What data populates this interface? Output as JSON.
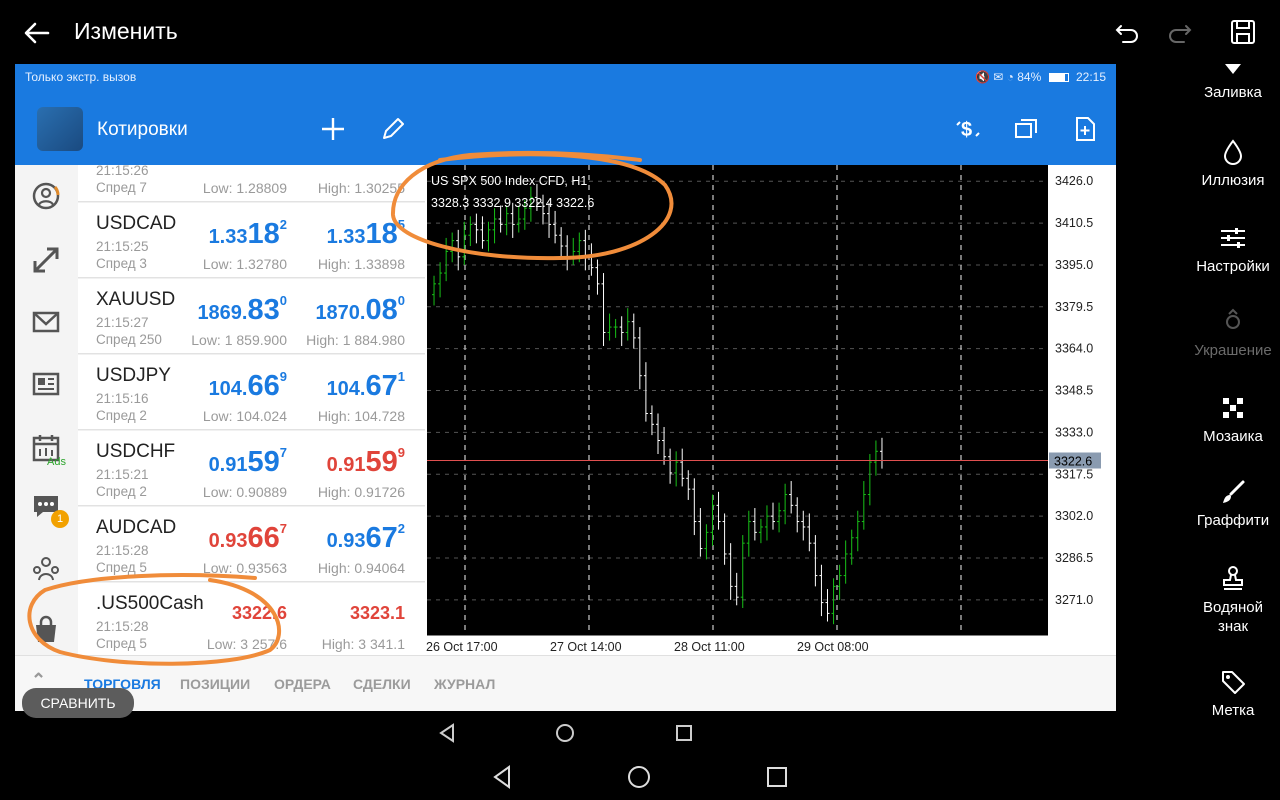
{
  "editor": {
    "title": "Изменить",
    "tools": [
      {
        "label": "Заливка",
        "icon": "fill-icon",
        "disabled": false
      },
      {
        "label": "Иллюзия",
        "icon": "drop-icon",
        "disabled": false
      },
      {
        "label": "Настройки",
        "icon": "sliders-icon",
        "disabled": false
      },
      {
        "label": "Украшение",
        "icon": "decoration-icon",
        "disabled": true
      },
      {
        "label": "Мозаика",
        "icon": "mosaic-icon",
        "disabled": false
      },
      {
        "label": "Граффити",
        "icon": "brush-icon",
        "disabled": false
      },
      {
        "label": "Водяной знак",
        "icon": "watermark-icon",
        "disabled": false
      },
      {
        "label": "Метка",
        "icon": "tag-icon",
        "disabled": false
      }
    ]
  },
  "statusbar": {
    "left": "Только экстр. вызов",
    "battery": "84%",
    "time": "22:15"
  },
  "appbar": {
    "title": "Котировки"
  },
  "leftnav": {
    "ads_label": "Ads",
    "chat_badge": "1"
  },
  "quotes": [
    {
      "symbol": "",
      "time": "21:15:26",
      "spread": "Спред 7",
      "bid_pre": "",
      "bid_big": "",
      "bid_sup": "",
      "ask_pre": "",
      "ask_big": "",
      "ask_sup": "",
      "low": "Low: 1.28809",
      "high": "High: 1.30255",
      "bid_color": "blue",
      "ask_color": "blue"
    },
    {
      "symbol": "USDCAD",
      "time": "21:15:25",
      "spread": "Спред 3",
      "bid_pre": "1.33",
      "bid_big": "18",
      "bid_sup": "2",
      "ask_pre": "1.33",
      "ask_big": "18",
      "ask_sup": "5",
      "low": "Low: 1.32780",
      "high": "High: 1.33898",
      "bid_color": "blue",
      "ask_color": "blue"
    },
    {
      "symbol": "XAUUSD",
      "time": "21:15:27",
      "spread": "Спред 250",
      "bid_pre": "1869.",
      "bid_big": "83",
      "bid_sup": "0",
      "ask_pre": "1870.",
      "ask_big": "08",
      "ask_sup": "0",
      "low": "Low: 1 859.900",
      "high": "High: 1 884.980",
      "bid_color": "blue",
      "ask_color": "blue"
    },
    {
      "symbol": "USDJPY",
      "time": "21:15:16",
      "spread": "Спред 2",
      "bid_pre": "104.",
      "bid_big": "66",
      "bid_sup": "9",
      "ask_pre": "104.",
      "ask_big": "67",
      "ask_sup": "1",
      "low": "Low: 104.024",
      "high": "High: 104.728",
      "bid_color": "blue",
      "ask_color": "blue"
    },
    {
      "symbol": "USDCHF",
      "time": "21:15:21",
      "spread": "Спред 2",
      "bid_pre": "0.91",
      "bid_big": "59",
      "bid_sup": "7",
      "ask_pre": "0.91",
      "ask_big": "59",
      "ask_sup": "9",
      "low": "Low: 0.90889",
      "high": "High: 0.91726",
      "bid_color": "blue",
      "ask_color": "red"
    },
    {
      "symbol": "AUDCAD",
      "time": "21:15:28",
      "spread": "Спред 5",
      "bid_pre": "0.93",
      "bid_big": "66",
      "bid_sup": "7",
      "ask_pre": "0.93",
      "ask_big": "67",
      "ask_sup": "2",
      "low": "Low: 0.93563",
      "high": "High: 0.94064",
      "bid_color": "red",
      "ask_color": "blue"
    },
    {
      "symbol": ".US500Cash",
      "time": "21:15:28",
      "spread": "Спред 5",
      "bid_plain": "3322.6",
      "ask_plain": "3323.1",
      "low": "Low: 3 257.6",
      "high": "High: 3 341.1",
      "bid_color": "red",
      "ask_color": "red"
    }
  ],
  "chart": {
    "title": "US SPX 500 Index CFD, H1",
    "ohlc": "3328.3 3332.9 3322.4 3322.6",
    "current_price_label": "3322.6",
    "y_ticks": [
      "3426.0",
      "3410.5",
      "3395.0",
      "3379.5",
      "3364.0",
      "3348.5",
      "3333.0",
      "3317.5",
      "3302.0",
      "3286.5",
      "3271.0"
    ],
    "x_ticks": [
      "26 Oct 17:00",
      "27 Oct 14:00",
      "28 Oct 11:00",
      "29 Oct 08:00"
    ],
    "colors": {
      "bull": "#18c018",
      "bear": "#ffffff",
      "bg": "#000000",
      "price_line": "#e05050",
      "grid": "#ffffff"
    }
  },
  "chart_data": {
    "type": "candlestick",
    "title": "US SPX 500 Index CFD, H1",
    "ylim": [
      3258,
      3432
    ],
    "current_price": 3322.6,
    "x_tick_labels": [
      "26 Oct 17:00",
      "27 Oct 14:00",
      "28 Oct 11:00",
      "29 Oct 08:00"
    ],
    "closes": [
      3388,
      3392,
      3400,
      3404,
      3398,
      3406,
      3410,
      3408,
      3404,
      3408,
      3412,
      3410,
      3414,
      3410,
      3412,
      3416,
      3420,
      3418,
      3414,
      3410,
      3406,
      3402,
      3398,
      3400,
      3404,
      3398,
      3394,
      3388,
      3370,
      3372,
      3372,
      3370,
      3374,
      3368,
      3354,
      3340,
      3336,
      3330,
      3324,
      3318,
      3322,
      3316,
      3312,
      3300,
      3290,
      3296,
      3306,
      3300,
      3288,
      3276,
      3272,
      3292,
      3300,
      3296,
      3298,
      3302,
      3300,
      3304,
      3310,
      3306,
      3300,
      3298,
      3292,
      3280,
      3270,
      3266,
      3276,
      3280,
      3288,
      3294,
      3300,
      3310,
      3322,
      3326,
      3322.6
    ]
  },
  "tabs": [
    "ТОРГОВЛЯ",
    "ПОЗИЦИИ",
    "ОРДЕРА",
    "СДЕЛКИ",
    "ЖУРНАЛ"
  ],
  "compare_label": "СРАВНИТЬ"
}
